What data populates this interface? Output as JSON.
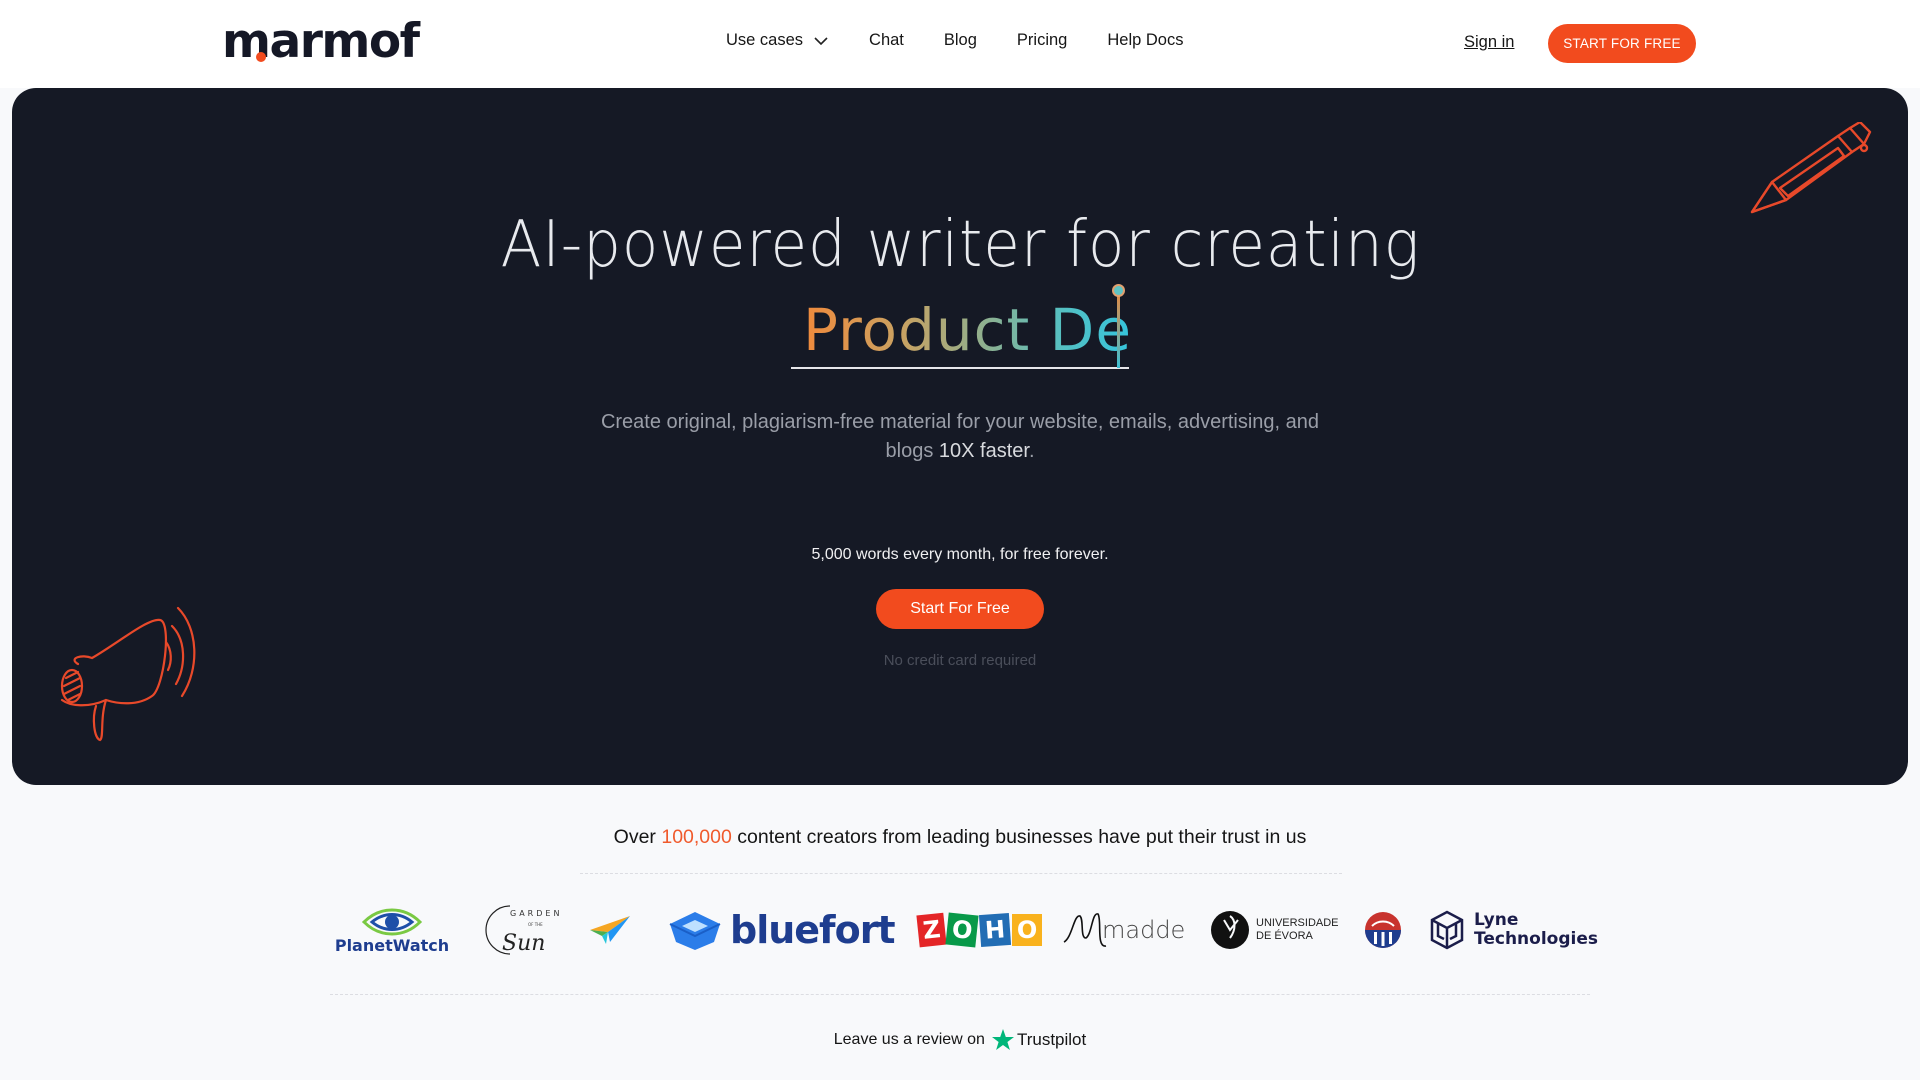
{
  "nav": {
    "logo": "marmof",
    "links": [
      {
        "label": "Use cases",
        "has_dropdown": true
      },
      {
        "label": "Chat"
      },
      {
        "label": "Blog"
      },
      {
        "label": "Pricing"
      },
      {
        "label": "Help Docs"
      }
    ],
    "sign_in": "Sign in",
    "cta": "START FOR FREE"
  },
  "hero": {
    "headline": "AI-powered writer for creating",
    "typed_text": "Product De",
    "subtitle_main": "Create original, plagiarism-free material for your website, emails, advertising, and blogs ",
    "subtitle_bold": "10X faster",
    "subtitle_end": ".",
    "free_words": "5,000 words every month, for free forever.",
    "cta": "Start For Free",
    "no_card": "No credit card required"
  },
  "trust": {
    "prefix": "Over ",
    "highlight": "100,000",
    "suffix": " content creators from leading businesses have put their trust in us",
    "logos": [
      "PlanetWatch",
      "Gardens of the Sun",
      "Paper plane logo",
      "bluefort",
      "ZOHO",
      "madde",
      "Universidade de Évora",
      "University crest",
      "Lyne Technologies"
    ],
    "gardens_text": "GARDENS",
    "gardens_small": "OF THE",
    "gardens_script": "Sun",
    "uevora_line1": "UNIVERSIDADE",
    "uevora_line2": "DE ÉVORA",
    "lyne_line1": "Lyne",
    "lyne_line2": "Technologies",
    "zoho_letters": [
      "Z",
      "O",
      "H",
      "O"
    ]
  },
  "review": {
    "label": "Leave us a review on",
    "brand": "Trustpilot"
  },
  "colors": {
    "accent": "#f24b1e",
    "hero_bg": "#151925",
    "trustpilot_green": "#00b67a"
  }
}
